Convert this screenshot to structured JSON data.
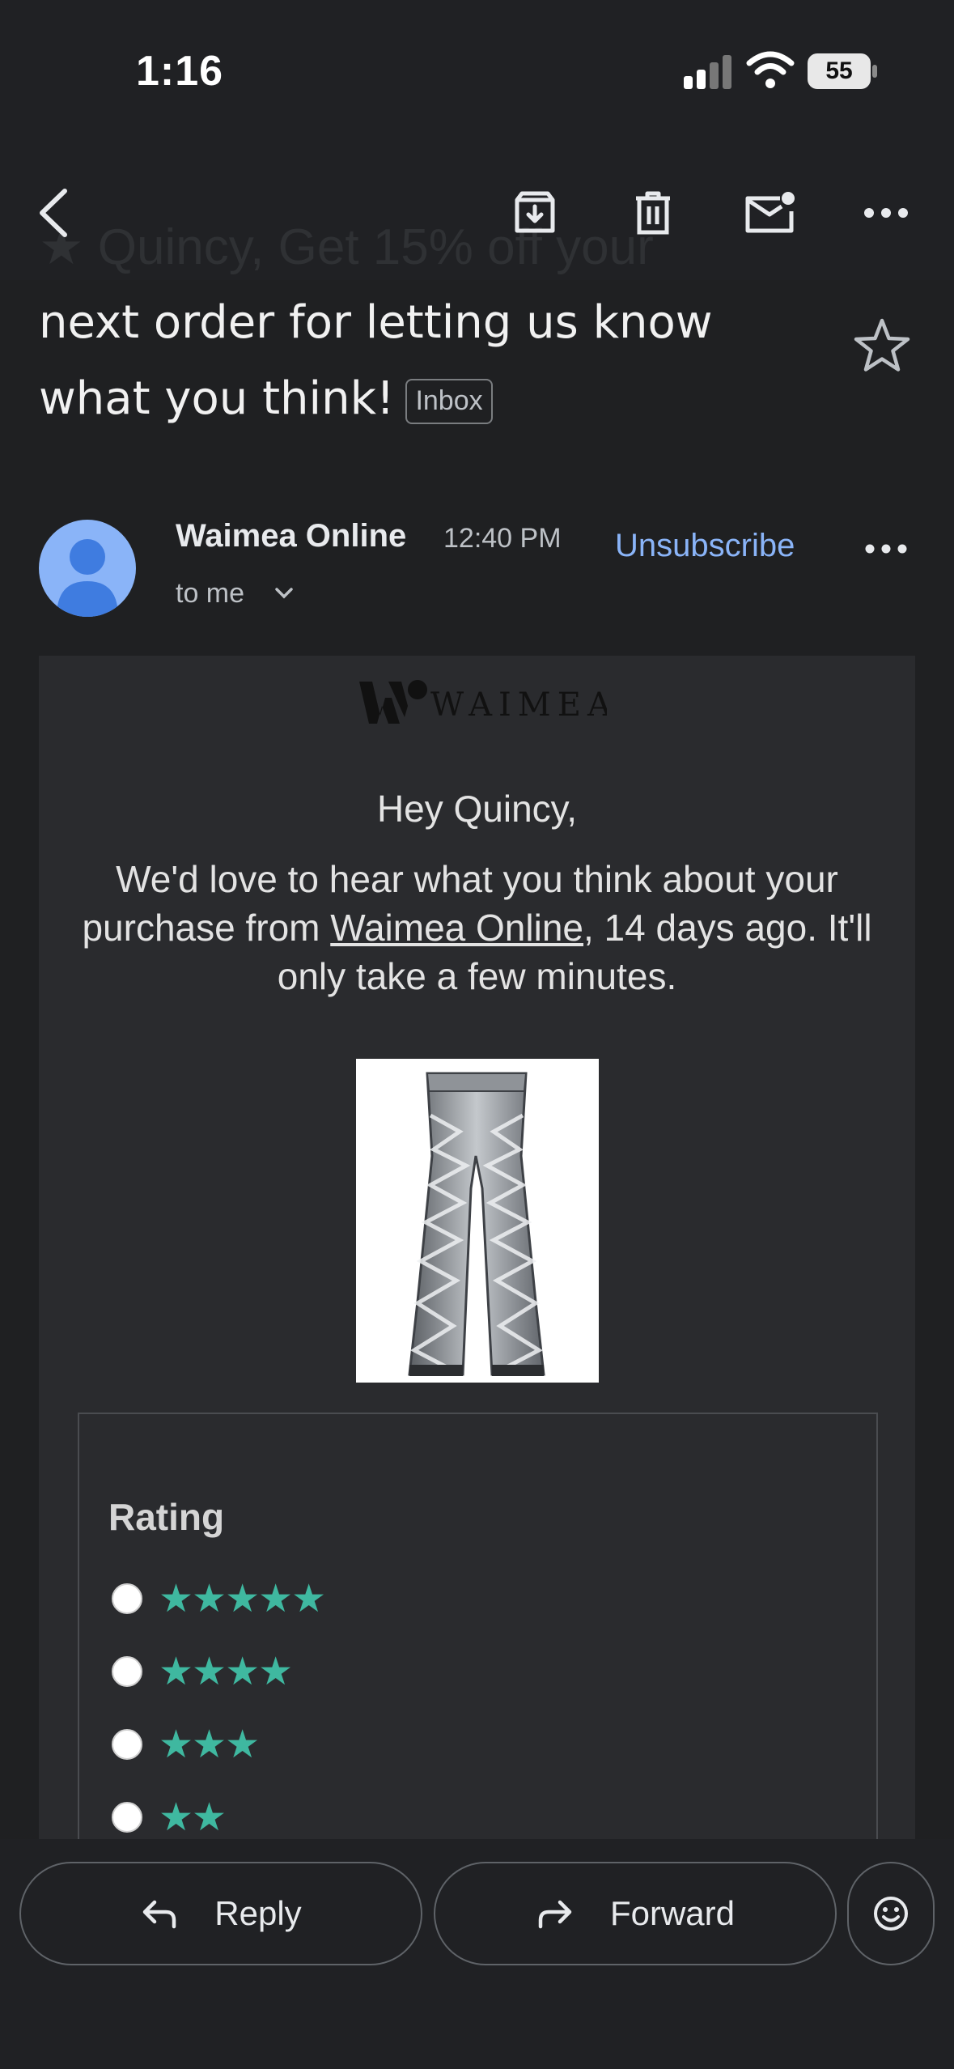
{
  "status_bar": {
    "time": "1:16",
    "battery": "55"
  },
  "toolbar": {
    "back_icon": "chevron-left-icon",
    "archive_icon": "archive-icon",
    "delete_icon": "trash-icon",
    "mark_unread_icon": "mail-unread-icon",
    "more_icon": "more-horizontal-icon"
  },
  "subject": {
    "ghost_text": "★ Quincy, Get 15% off your",
    "text": "next order for letting us know what you think!",
    "label": "Inbox"
  },
  "sender": {
    "name": "Waimea Online",
    "time": "12:40 PM",
    "recipient": "to me",
    "unsubscribe": "Unsubscribe"
  },
  "email": {
    "brand": "WAIMEA",
    "greeting": "Hey Quincy,",
    "message_before": "We'd love to hear what you think about your purchase from ",
    "message_link": "Waimea Online",
    "message_after": ", 14 days ago. It'll only take a few minutes.",
    "rating_title": "Rating",
    "rating_options": [
      "★★★★★",
      "★★★★",
      "★★★",
      "★★"
    ],
    "star_color": "#3fb8a0"
  },
  "actions": {
    "reply": "Reply",
    "forward": "Forward",
    "emoji_icon": "smiley-icon"
  }
}
